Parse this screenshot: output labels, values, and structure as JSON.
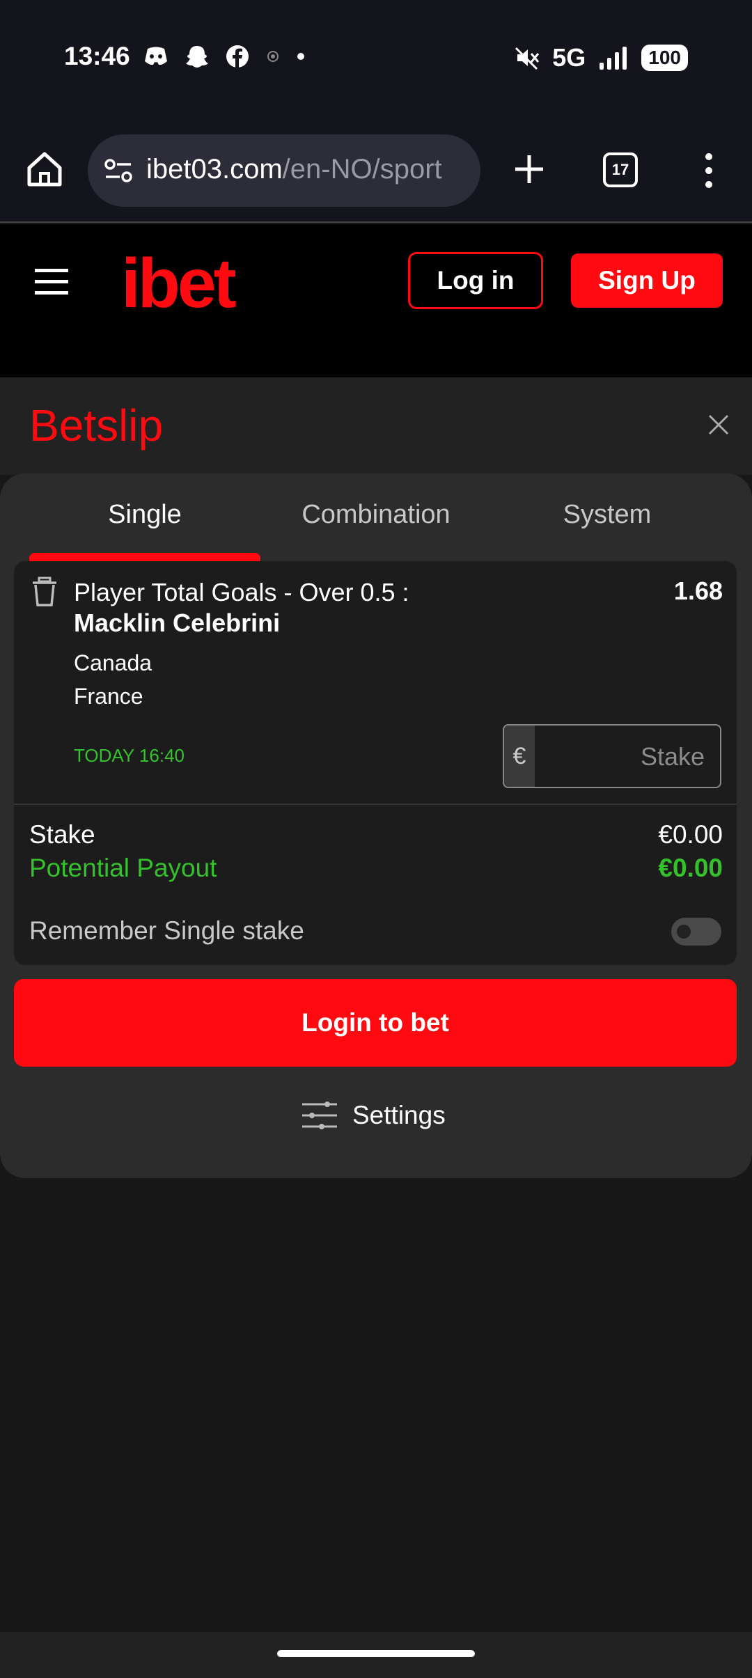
{
  "status_bar": {
    "time": "13:46",
    "network": "5G",
    "battery": "100",
    "icons_left": [
      "discord-icon",
      "snapchat-icon",
      "facebook-icon",
      "small-circle-icon",
      "dot-icon"
    ],
    "icons_right": [
      "mute-icon",
      "signal-icon",
      "battery-icon"
    ]
  },
  "browser": {
    "url_domain": "ibet03.com",
    "url_path": "/en-NO/sport",
    "tab_count": "17"
  },
  "header": {
    "logo": "ibet",
    "login_label": "Log in",
    "signup_label": "Sign Up"
  },
  "betslip": {
    "title": "Betslip",
    "tabs": [
      {
        "label": "Single",
        "active": true
      },
      {
        "label": "Combination",
        "active": false
      },
      {
        "label": "System",
        "active": false
      }
    ],
    "bet": {
      "market": "Player Total Goals - Over 0.5 :",
      "player": "Macklin Celebrini",
      "odds": "1.68",
      "team_home": "Canada",
      "team_away": "France",
      "time": "TODAY 16:40",
      "stake_currency": "€",
      "stake_placeholder": "Stake"
    },
    "summary": {
      "stake_label": "Stake",
      "stake_value": "€0.00",
      "payout_label": "Potential Payout",
      "payout_value": "€0.00",
      "remember_label": "Remember Single stake",
      "remember_enabled": false
    },
    "login_bet_label": "Login to bet",
    "settings_label": "Settings"
  },
  "colors": {
    "brand_red": "#ff0a10",
    "accent_green": "#35c12b",
    "background": "#181818",
    "panel": "#2c2c2c"
  }
}
